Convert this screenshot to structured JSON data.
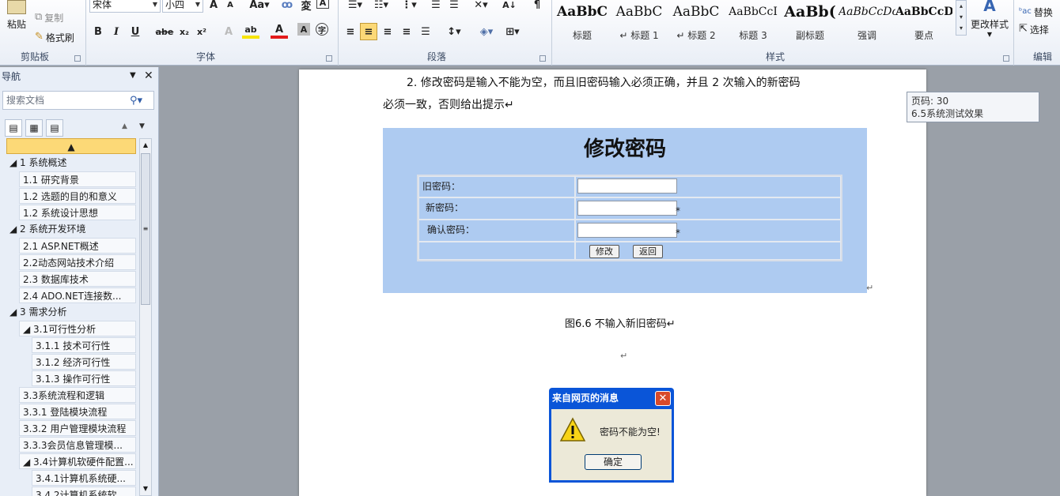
{
  "ribbon": {
    "clipboard": {
      "paste": "粘贴",
      "copy": "复制",
      "format_painter": "格式刷",
      "label": "剪贴板"
    },
    "font": {
      "name": "宋体",
      "size": "小四",
      "label": "字体"
    },
    "paragraph": {
      "label": "段落"
    },
    "styles": {
      "label": "样式",
      "items": [
        {
          "sample": "AaBbC",
          "name": "标题"
        },
        {
          "sample": "AaBbC",
          "name": "↵ 标题 1"
        },
        {
          "sample": "AaBbC",
          "name": "↵ 标题 2"
        },
        {
          "sample": "AaBbCcI",
          "name": "标题 3"
        },
        {
          "sample": "AaBb(",
          "name": "副标题"
        },
        {
          "sample": "AaBbCcDc",
          "name": "强调"
        },
        {
          "sample": "AaBbCcD",
          "name": "要点"
        }
      ],
      "change_styles": "更改样式"
    },
    "editing": {
      "replace": "替换",
      "select": "选择",
      "label": "编辑"
    }
  },
  "nav": {
    "title": "导航",
    "search_placeholder": "搜索文档",
    "items": [
      {
        "text": "◢ 1 系统概述",
        "level": 0
      },
      {
        "text": "1.1 研究背景",
        "level": 1
      },
      {
        "text": "1.2 选题的目的和意义",
        "level": 1
      },
      {
        "text": "1.2 系统设计思想",
        "level": 1
      },
      {
        "text": "◢ 2 系统开发环境",
        "level": 0
      },
      {
        "text": "2.1 ASP.NET概述",
        "level": 1
      },
      {
        "text": "2.2动态网站技术介绍",
        "level": 1
      },
      {
        "text": "2.3 数据库技术",
        "level": 1
      },
      {
        "text": "2.4  ADO.NET连接数...",
        "level": 1
      },
      {
        "text": "◢ 3 需求分析",
        "level": 0
      },
      {
        "text": "◢ 3.1可行性分析",
        "level": 1
      },
      {
        "text": "3.1.1 技术可行性",
        "level": 2
      },
      {
        "text": "3.1.2 经济可行性",
        "level": 2
      },
      {
        "text": "3.1.3 操作可行性",
        "level": 2
      },
      {
        "text": "3.3系统流程和逻辑",
        "level": 1
      },
      {
        "text": "3.3.1 登陆模块流程",
        "level": 1
      },
      {
        "text": "3.3.2 用户管理模块流程",
        "level": 1
      },
      {
        "text": "3.3.3会员信息管理模...",
        "level": 1
      },
      {
        "text": "◢ 3.4计算机软硬件配置...",
        "level": 1
      },
      {
        "text": "3.4.1计算机系统硬...",
        "level": 2
      },
      {
        "text": "3.4.2计算机系统软...",
        "level": 2
      }
    ]
  },
  "document": {
    "para_line1": "2. 修改密码是输入不能为空，而且旧密码输入必须正确，并且 2 次输入的新密码",
    "para_line2": "必须一致，否则给出提示↵",
    "figure": {
      "title": "修改密码",
      "old_pw_label": "旧密码：",
      "new_pw_label": "新密码：",
      "confirm_pw_label": "确认密码：",
      "required_mark": "*",
      "modify_button": "修改",
      "back_button": "返回"
    },
    "caption": "图6.6 不输入新旧密码↵",
    "empty_para": "↵"
  },
  "dialog": {
    "title": "来自网页的消息",
    "message": "密码不能为空!",
    "ok": "确定"
  },
  "tooltip": {
    "line1": "页码: 30",
    "line2": "6.5系统测试效果"
  }
}
